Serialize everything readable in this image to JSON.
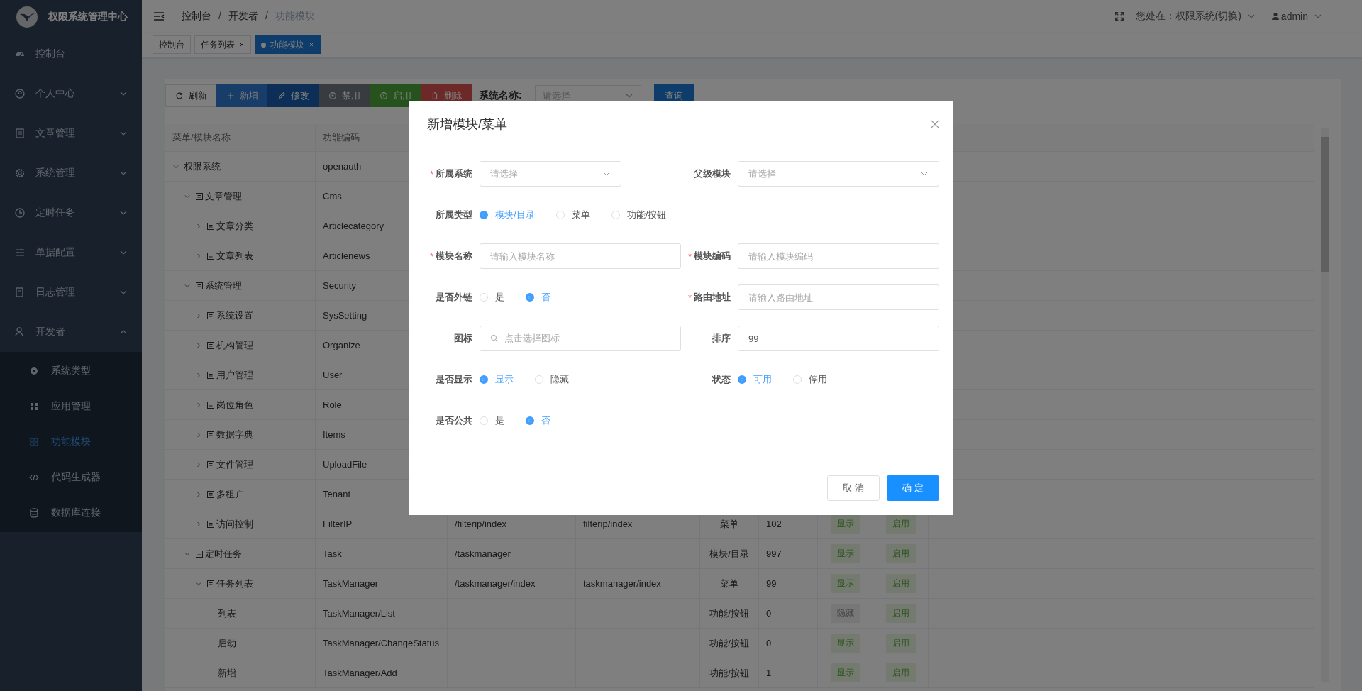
{
  "sidebar": {
    "title": "权限系统管理中心",
    "items": [
      {
        "label": "控制台"
      },
      {
        "label": "个人中心",
        "expanded": false
      },
      {
        "label": "文章管理",
        "expanded": false
      },
      {
        "label": "系统管理",
        "expanded": false
      },
      {
        "label": "定时任务",
        "expanded": false
      },
      {
        "label": "单据配置",
        "expanded": false
      },
      {
        "label": "日志管理",
        "expanded": false
      },
      {
        "label": "开发者",
        "expanded": true,
        "children": [
          {
            "label": "系统类型",
            "selected": false
          },
          {
            "label": "应用管理",
            "selected": false
          },
          {
            "label": "功能模块",
            "selected": true
          },
          {
            "label": "代码生成器",
            "selected": false
          },
          {
            "label": "数据库连接",
            "selected": false
          }
        ]
      }
    ]
  },
  "header": {
    "breadcrumb": [
      "控制台",
      "开发者",
      "功能模块"
    ],
    "separator": "/",
    "location": "您处在：权限系统(切换)",
    "user": "admin"
  },
  "tabs": [
    {
      "label": "控制台",
      "selected": false,
      "closable": false
    },
    {
      "label": "任务列表",
      "selected": false,
      "closable": true
    },
    {
      "label": "功能模块",
      "selected": true,
      "closable": true
    }
  ],
  "toolbar": {
    "buttons": [
      {
        "label": "刷新",
        "kind": "plain"
      },
      {
        "label": "新增",
        "kind": "primary"
      },
      {
        "label": "修改",
        "kind": "edit"
      },
      {
        "label": "禁用",
        "kind": "disable"
      },
      {
        "label": "启用",
        "kind": "enable"
      },
      {
        "label": "删除",
        "kind": "danger"
      }
    ],
    "filter_label": "系统名称:",
    "filter_placeholder": "请选择",
    "query": "查询"
  },
  "table": {
    "columns": [
      "菜单/模块名称",
      "功能编码"
    ],
    "rows": [
      {
        "name": "权限系统",
        "code": "openauth",
        "expanded": true,
        "children": [
          {
            "name": "文章管理",
            "code": "Cms",
            "expanded": true,
            "children": [
              {
                "name": "文章分类",
                "code": "Articlecategory",
                "expanded": false
              },
              {
                "name": "文章列表",
                "code": "Articlenews",
                "expanded": false
              }
            ]
          },
          {
            "name": "系统管理",
            "code": "Security",
            "expanded": true,
            "children": [
              {
                "name": "系统设置",
                "code": "SysSetting",
                "expanded": false
              },
              {
                "name": "机构管理",
                "code": "Organize",
                "expanded": false
              },
              {
                "name": "用户管理",
                "code": "User",
                "expanded": false
              },
              {
                "name": "岗位角色",
                "code": "Role",
                "expanded": false
              },
              {
                "name": "数据字典",
                "code": "Items",
                "expanded": false
              },
              {
                "name": "文件管理",
                "code": "UploadFile",
                "expanded": false
              },
              {
                "name": "多租户",
                "code": "Tenant",
                "expanded": false
              },
              {
                "name": "访问控制",
                "code": "FilterIP",
                "expanded": false,
                "column_3": "/filterip/index",
                "column_4": "filterip/index",
                "column_5": "菜单",
                "column_6": "102",
                "column_7": {
                  "text": "显示",
                  "on": true
                },
                "column_8": {
                  "text": "启用",
                  "on": true
                }
              }
            ]
          },
          {
            "name": "定时任务",
            "code": "Task",
            "expanded": true,
            "column_3": "/taskmanager",
            "column_5": "模块/目录",
            "column_6": "997",
            "column_7": {
              "text": "显示",
              "on": true
            },
            "column_8": {
              "text": "启用",
              "on": true
            },
            "children": [
              {
                "name": "任务列表",
                "code": "TaskManager",
                "expanded": true,
                "column_3": "/taskmanager/index",
                "column_4": "taskmanager/index",
                "column_5": "菜单",
                "column_6": "99",
                "column_7": {
                  "text": "显示",
                  "on": true
                },
                "column_8": {
                  "text": "启用",
                  "on": true
                },
                "children": [
                  {
                    "name": "列表",
                    "code": "TaskManager/List",
                    "column_5": "功能/按钮",
                    "column_6": "0",
                    "column_7": {
                      "text": "隐藏",
                      "on": false
                    },
                    "column_8": {
                      "text": "启用",
                      "on": true
                    }
                  },
                  {
                    "name": "启动",
                    "code": "TaskManager/ChangeStatus",
                    "column_5": "功能/按钮",
                    "column_6": "0",
                    "column_7": {
                      "text": "显示",
                      "on": true
                    },
                    "column_8": {
                      "text": "启用",
                      "on": true
                    }
                  },
                  {
                    "name": "新增",
                    "code": "TaskManager/Add",
                    "column_5": "功能/按钮",
                    "column_6": "1",
                    "column_7": {
                      "text": "显示",
                      "on": true
                    },
                    "column_8": {
                      "text": "启用",
                      "on": true
                    }
                  }
                ]
              }
            ]
          }
        ]
      }
    ]
  },
  "dialog": {
    "title": "新增模块/菜单",
    "rows": [
      [
        {
          "kind": "select",
          "label": "所属系统",
          "mark": "*",
          "placeholder": "请选择"
        },
        {
          "kind": "select",
          "label": "父级模块",
          "placeholder": "请选择"
        }
      ],
      [
        {
          "kind": "radio",
          "label": "所属类型",
          "options": [
            {
              "label": "模块/目录",
              "selected": true
            },
            {
              "label": "菜单",
              "selected": false
            },
            {
              "label": "功能/按钮",
              "selected": false
            }
          ]
        }
      ],
      [
        {
          "kind": "input",
          "label": "模块名称",
          "mark": "*",
          "placeholder": "请输入模块名称"
        },
        {
          "kind": "input",
          "label": "模块编码",
          "mark": "*",
          "placeholder": "请输入模块编码"
        }
      ],
      [
        {
          "kind": "radio",
          "label": "是否外链",
          "options": [
            {
              "label": "是",
              "selected": false
            },
            {
              "label": "否",
              "selected": true
            }
          ]
        },
        {
          "kind": "input",
          "label": "路由地址",
          "mark": "*",
          "placeholder": "请输入路由地址"
        }
      ],
      [
        {
          "kind": "search",
          "label": "图标",
          "placeholder": "点击选择图标"
        },
        {
          "kind": "input",
          "label": "排序",
          "value": "99"
        }
      ],
      [
        {
          "kind": "radio",
          "label": "是否显示",
          "options": [
            {
              "label": "显示",
              "selected": true
            },
            {
              "label": "隐藏",
              "selected": false
            }
          ]
        },
        {
          "kind": "radio",
          "label": "状态",
          "options": [
            {
              "label": "可用",
              "selected": true
            },
            {
              "label": "停用",
              "selected": false
            }
          ]
        }
      ],
      [
        {
          "kind": "radio",
          "label": "是否公共",
          "options": [
            {
              "label": "是",
              "selected": false
            },
            {
              "label": "否",
              "selected": true
            }
          ]
        }
      ]
    ],
    "cancel": "取 消",
    "ok": "确 定"
  }
}
